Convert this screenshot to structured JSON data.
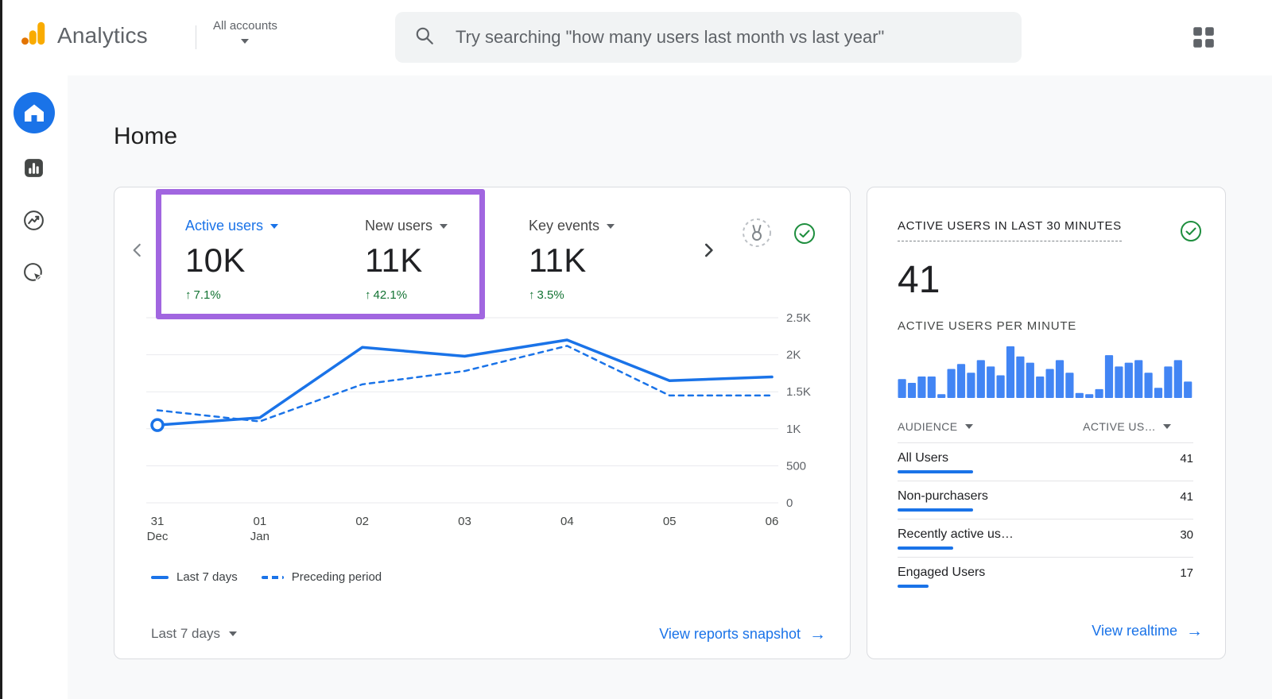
{
  "colors": {
    "primary_blue": "#1a73e8",
    "bar_blue": "#4285f4",
    "positive_green": "#137333",
    "annotation_purple": "#a166e0",
    "logo_amber": "#f9ab00",
    "logo_orange": "#e37400"
  },
  "header": {
    "app_name": "Analytics",
    "account_label": "All accounts",
    "search_placeholder": "Try searching \"how many users last month vs last year\""
  },
  "page": {
    "title": "Home"
  },
  "overview": {
    "metrics": [
      {
        "label": "Active users",
        "value": "10K",
        "delta": "7.1%"
      },
      {
        "label": "New users",
        "value": "11K",
        "delta": "42.1%"
      },
      {
        "label": "Key events",
        "value": "11K",
        "delta": "3.5%"
      }
    ],
    "legend_last7": "Last 7 days",
    "legend_preceding": "Preceding period",
    "date_range": "Last 7 days",
    "snapshot_link": "View reports snapshot"
  },
  "realtime": {
    "title": "ACTIVE USERS IN LAST 30 MINUTES",
    "value": "41",
    "per_minute": "ACTIVE USERS PER MINUTE",
    "headers": {
      "audience": "AUDIENCE",
      "active": "ACTIVE US…"
    },
    "rows": [
      {
        "name": "All Users",
        "value": 41
      },
      {
        "name": "Non-purchasers",
        "value": 41
      },
      {
        "name": "Recently active us…",
        "value": 30
      },
      {
        "name": "Engaged Users",
        "value": 17
      }
    ],
    "link": "View realtime"
  },
  "chart_data": [
    {
      "type": "line",
      "title": "Active users over time",
      "x": [
        "31 Dec",
        "01 Jan",
        "02",
        "03",
        "04",
        "05",
        "06"
      ],
      "series": [
        {
          "name": "Last 7 days",
          "style": "solid",
          "values": [
            1050,
            1150,
            2100,
            1980,
            2200,
            1650,
            1700
          ]
        },
        {
          "name": "Preceding period",
          "style": "dashed",
          "values": [
            1250,
            1100,
            1600,
            1780,
            2120,
            1450,
            1450
          ]
        }
      ],
      "ylim": [
        0,
        2500
      ],
      "yticks": [
        "0",
        "500",
        "1K",
        "1.5K",
        "2K",
        "2.5K"
      ],
      "grid": true,
      "legend_position": "bottom"
    },
    {
      "type": "bar",
      "title": "Active users per minute",
      "values": [
        15,
        12,
        17,
        17,
        3,
        23,
        27,
        20,
        30,
        25,
        18,
        41,
        33,
        28,
        17,
        23,
        30,
        20,
        4,
        3,
        7,
        34,
        25,
        28,
        30,
        20,
        8,
        25,
        30,
        13
      ]
    }
  ]
}
